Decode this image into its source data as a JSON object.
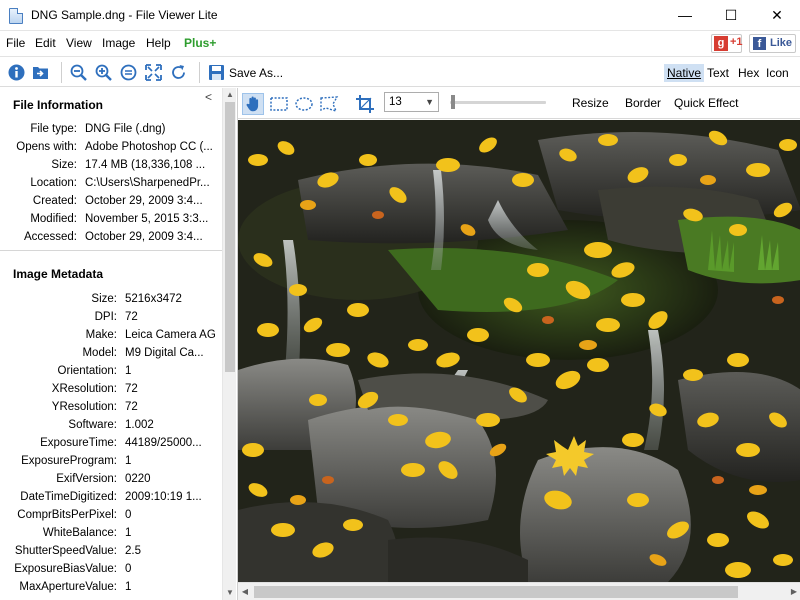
{
  "window": {
    "title": "DNG Sample.dng - File Viewer Lite",
    "minimize": "—",
    "maximize": "☐",
    "close": "✕"
  },
  "menu": {
    "items": [
      "File",
      "Edit",
      "View",
      "Image",
      "Help"
    ],
    "plus": "Plus+",
    "google_g": "g",
    "google_plus": "+1",
    "facebook_f": "f",
    "facebook_like": "Like"
  },
  "toolbar": {
    "save_as": "Save As...",
    "view_modes": [
      "Native",
      "Text",
      "Hex",
      "Icon"
    ],
    "active_view_mode": "Native"
  },
  "file_information": {
    "title": "File Information",
    "collapse": "<",
    "rows": [
      {
        "label": "File type:",
        "value": "DNG File (.dng)"
      },
      {
        "label": "Opens with:",
        "value": "Adobe Photoshop CC (..."
      },
      {
        "label": "Size:",
        "value": "17.4 MB (18,336,108 ..."
      },
      {
        "label": "Location:",
        "value": "C:\\Users\\SharpenedPr..."
      },
      {
        "label": "Created:",
        "value": "October 29, 2009 3:4..."
      },
      {
        "label": "Modified:",
        "value": "November 5, 2015 3:3..."
      },
      {
        "label": "Accessed:",
        "value": "October 29, 2009 3:4..."
      }
    ]
  },
  "image_metadata": {
    "title": "Image Metadata",
    "rows": [
      {
        "label": "Size:",
        "value": "5216x3472"
      },
      {
        "label": "DPI:",
        "value": "72"
      },
      {
        "label": "Make:",
        "value": "Leica Camera AG"
      },
      {
        "label": "Model:",
        "value": "M9 Digital Ca..."
      },
      {
        "label": "Orientation:",
        "value": "1"
      },
      {
        "label": "XResolution:",
        "value": "72"
      },
      {
        "label": "YResolution:",
        "value": "72"
      },
      {
        "label": "Software:",
        "value": "1.002"
      },
      {
        "label": "ExposureTime:",
        "value": "44189/25000..."
      },
      {
        "label": "ExposureProgram:",
        "value": "1"
      },
      {
        "label": "ExifVersion:",
        "value": "0220"
      },
      {
        "label": "DateTimeDigitized:",
        "value": "2009:10:19 1..."
      },
      {
        "label": "ComprBitsPerPixel:",
        "value": "0"
      },
      {
        "label": "WhiteBalance:",
        "value": "1"
      },
      {
        "label": "ShutterSpeedValue:",
        "value": "2.5"
      },
      {
        "label": "ExposureBiasValue:",
        "value": "0"
      },
      {
        "label": "MaxApertureValue:",
        "value": "1"
      }
    ]
  },
  "image_toolbar": {
    "zoom_value": "13",
    "actions": [
      "Resize",
      "Border",
      "Quick Effect"
    ]
  },
  "colors": {
    "accent": "#2e6fbd",
    "active_bg": "#cfe0f3",
    "plus_green": "#2e9d2e",
    "google_red": "#d73d32",
    "facebook_blue": "#3b5998"
  }
}
